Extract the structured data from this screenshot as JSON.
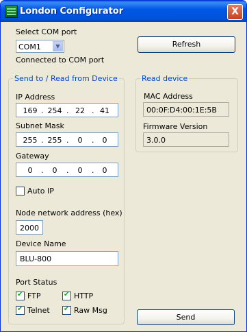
{
  "window": {
    "title": "London Configurator",
    "close": "X"
  },
  "com": {
    "label": "Select COM port",
    "selected": "COM1",
    "status": "Connected to COM port"
  },
  "refresh_label": "Refresh",
  "send_group": {
    "title": "Send to / Read from Device",
    "ip_label": "IP Address",
    "ip": [
      "169",
      "254",
      "22",
      "41"
    ],
    "subnet_label": "Subnet Mask",
    "subnet": [
      "255",
      "255",
      "0",
      "0"
    ],
    "gateway_label": "Gateway",
    "gateway": [
      "0",
      "0",
      "0",
      "0"
    ],
    "autoip_label": "Auto IP",
    "autoip_checked": false,
    "node_label": "Node network address (hex)",
    "node_value": "2000",
    "device_label": "Device Name",
    "device_value": "BLU-800",
    "port_label": "Port Status",
    "ports": [
      {
        "label": "FTP",
        "checked": true
      },
      {
        "label": "HTTP",
        "checked": true
      },
      {
        "label": "Telnet",
        "checked": true
      },
      {
        "label": "Raw Msg",
        "checked": true
      }
    ]
  },
  "read_group": {
    "title": "Read device",
    "mac_label": "MAC Address",
    "mac": "00:0F:D4:00:1E:5B",
    "fw_label": "Firmware Version",
    "fw": "3.0.0"
  },
  "send_label": "Send"
}
